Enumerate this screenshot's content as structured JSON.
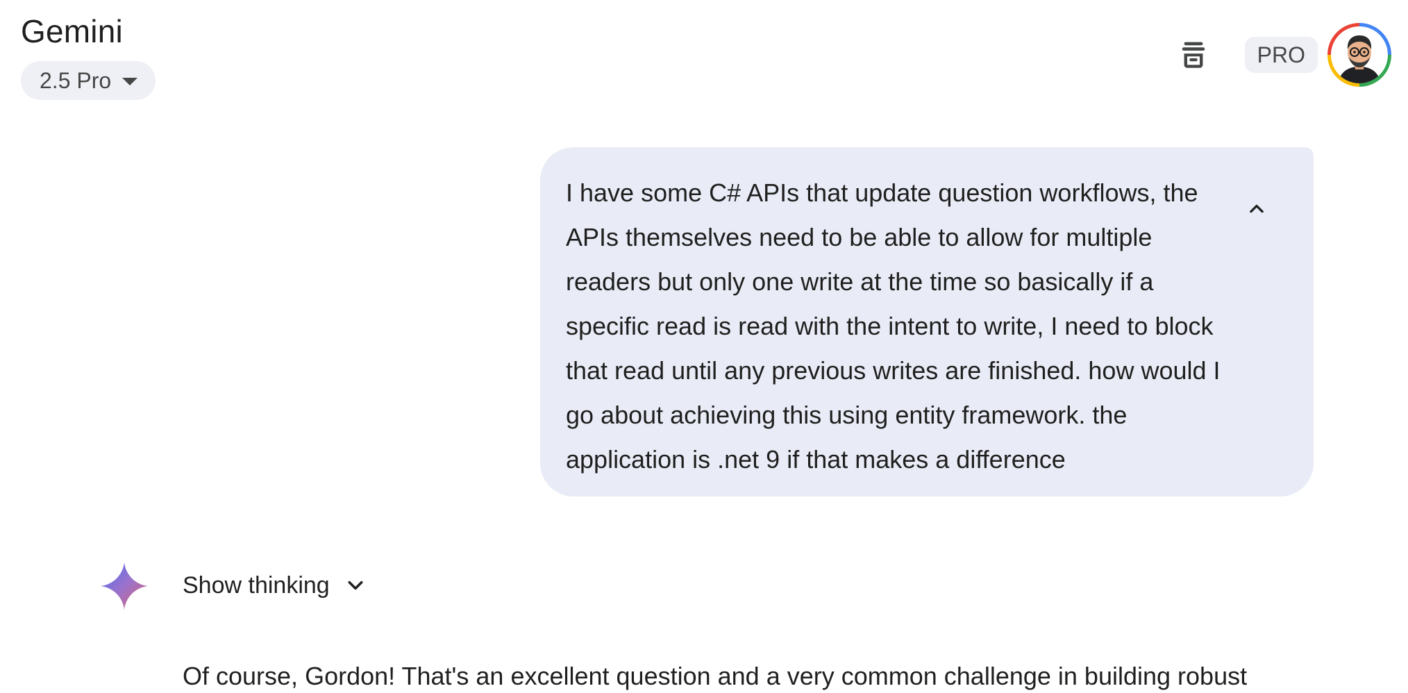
{
  "header": {
    "app_title": "Gemini",
    "model_label": "2.5 Pro",
    "pro_badge": "PRO"
  },
  "icons": {
    "clear": "clear-all-icon",
    "model_caret": "caret-down-icon",
    "collapse": "chevron-up-icon",
    "spark": "gemini-spark-icon",
    "thinking_expand": "chevron-down-icon",
    "avatar": "user-avatar"
  },
  "colors": {
    "bubble_bg": "#e9ecf6",
    "chip_bg": "#eef0f6",
    "spark_start": "#4e6ef2",
    "spark_end": "#d96570"
  },
  "conversation": {
    "user_message": "I have some C# APIs that update question workflows, the APIs themselves need to be able to allow for multiple readers but only one write at the time so basically if a specific read is read with the intent to write, I need to block that read until any previous writes are finished. how would I go about achieving this using entity framework. the application is .net 9 if that makes a difference",
    "show_thinking_label": "Show thinking",
    "response_preview": "Of course, Gordon! That's an excellent question and a very common challenge in building robust"
  }
}
